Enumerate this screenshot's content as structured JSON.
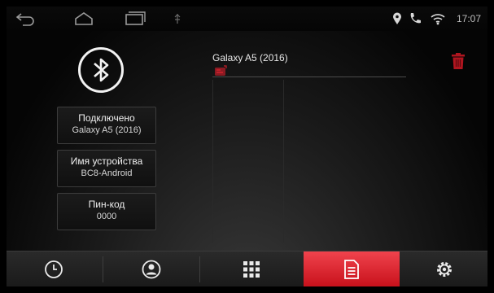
{
  "status_bar": {
    "time": "17:07",
    "icons": [
      "back-icon",
      "home-icon",
      "recent-apps-icon",
      "usb-icon",
      "location-icon",
      "phone-call-icon",
      "wifi-icon"
    ]
  },
  "left_panel": {
    "bluetooth_icon": "bluetooth-icon",
    "connection": {
      "label": "Подключено",
      "value": "Galaxy A5 (2016)"
    },
    "device_name": {
      "label": "Имя устройства",
      "value": "BC8-Android"
    },
    "pin": {
      "label": "Пин-код",
      "value": "0000"
    }
  },
  "paired_list": {
    "items": [
      {
        "name": "Galaxy A5 (2016)",
        "icon": "phone-icon"
      }
    ],
    "delete_icon": "trash-icon"
  },
  "bottom_nav": {
    "items": [
      {
        "icon": "clock-icon",
        "name": "recent-calls"
      },
      {
        "icon": "contacts-icon",
        "name": "contacts"
      },
      {
        "icon": "dialpad-icon",
        "name": "dialpad"
      },
      {
        "icon": "device-list-icon",
        "name": "device-list",
        "active": true
      },
      {
        "icon": "gear-icon",
        "name": "settings"
      }
    ],
    "accent_color": "#e0252f"
  }
}
